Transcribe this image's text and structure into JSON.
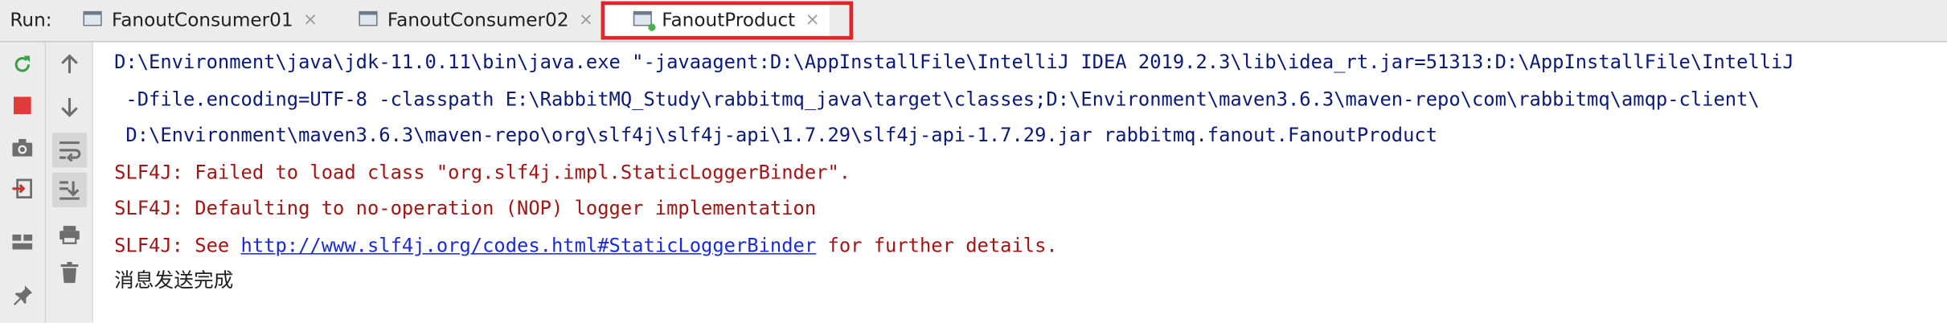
{
  "run_panel": {
    "label": "Run:",
    "tabs": [
      {
        "name": "FanoutConsumer01",
        "active": false
      },
      {
        "name": "FanoutConsumer02",
        "active": false
      },
      {
        "name": "FanoutProduct",
        "active": true
      }
    ],
    "close_glyph": "×"
  },
  "toolbar_left": [
    "rerun-icon",
    "stop-icon",
    "dump-threads-icon",
    "restore-layout-icon",
    "layout-icon",
    "pin-icon"
  ],
  "toolbar_right": [
    "up-arrow-icon",
    "down-arrow-icon",
    "soft-wrap-icon",
    "scroll-to-end-icon",
    "print-icon",
    "trash-icon"
  ],
  "console": {
    "command_lines": [
      "D:\\Environment\\java\\jdk-11.0.11\\bin\\java.exe \"-javaagent:D:\\AppInstallFile\\IntelliJ IDEA 2019.2.3\\lib\\idea_rt.jar=51313:D:\\AppInstallFile\\IntelliJ",
      " -Dfile.encoding=UTF-8 -classpath E:\\RabbitMQ_Study\\rabbitmq_java\\target\\classes;D:\\Environment\\maven3.6.3\\maven-repo\\com\\rabbitmq\\amqp-client\\",
      " D:\\Environment\\maven3.6.3\\maven-repo\\org\\slf4j\\slf4j-api\\1.7.29\\slf4j-api-1.7.29.jar rabbitmq.fanout.FanoutProduct"
    ],
    "slf4j_line1": "SLF4J: Failed to load class \"org.slf4j.impl.StaticLoggerBinder\".",
    "slf4j_line2": "SLF4J: Defaulting to no-operation (NOP) logger implementation",
    "slf4j_line3_prefix": "SLF4J: See ",
    "slf4j_link": "http://www.slf4j.org/codes.html#StaticLoggerBinder",
    "slf4j_line3_suffix": " for further details.",
    "output_message": "消息发送完成"
  },
  "colors": {
    "command": "#0b1a7a",
    "error": "#a31515",
    "link": "#1a2bd6",
    "highlight_border": "#e0262a"
  }
}
